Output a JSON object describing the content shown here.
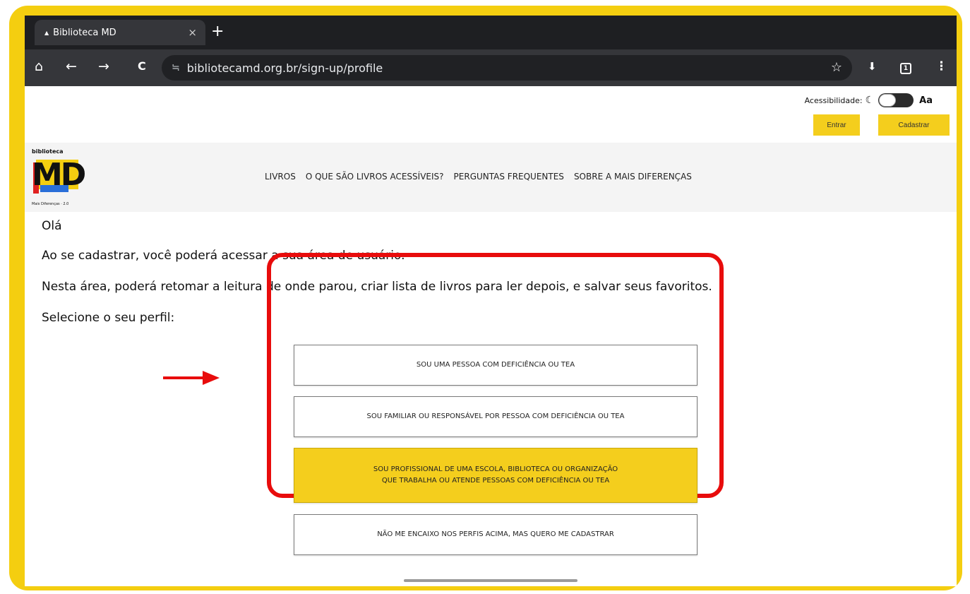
{
  "browser": {
    "tab_title": "Biblioteca MD",
    "tab_close": "×",
    "new_tab": "+",
    "url": "bibliotecamd.org.br/sign-up/profile",
    "icons": {
      "home": "⌂",
      "back": "←",
      "forward": "→",
      "reload": "C",
      "site_settings": "≒",
      "star": "☆",
      "mic": "🎙",
      "tab_count": "1",
      "menu": "⋮"
    }
  },
  "accessibility": {
    "label": "Acessibilidade:",
    "moon": "☾",
    "text_size": "Aa"
  },
  "header": {
    "login_label": "Entrar",
    "signup_label": "Cadastrar"
  },
  "logo": {
    "top_word": "biblioteca",
    "letters": "MD",
    "tagline": "Mais Diferenças · 2.0"
  },
  "nav": {
    "items": [
      "LIVROS",
      "O QUE SÃO LIVROS ACESSÍVEIS?",
      "PERGUNTAS FREQUENTES",
      "SOBRE A MAIS DIFERENÇAS"
    ]
  },
  "content": {
    "greeting": "Olá",
    "line1": "Ao se cadastrar, você poderá acessar a sua área de usuário.",
    "line2": "Nesta área, poderá retomar a leitura de onde parou, criar lista de livros para ler depois, e salvar seus favoritos.",
    "line3": "Selecione o seu perfil:"
  },
  "profiles": [
    {
      "label": "SOU UMA PESSOA COM DEFICIÊNCIA OU TEA",
      "selected": false
    },
    {
      "label": "SOU FAMILIAR OU RESPONSÁVEL POR PESSOA COM DEFICIÊNCIA OU TEA",
      "selected": false
    },
    {
      "label_line1": "SOU PROFISSIONAL DE UMA ESCOLA, BIBLIOTECA OU ORGANIZAÇÃO",
      "label_line2": "QUE TRABALHA OU ATENDE PESSOAS COM DEFICIÊNCIA OU TEA",
      "selected": true
    },
    {
      "label": "NÃO ME ENCAIXO NOS PERFIS ACIMA, MAS QUERO ME CADASTRAR",
      "selected": false
    }
  ],
  "colors": {
    "frame": "#f4ce10",
    "accent_yellow": "#f4ce1d",
    "highlight_red": "#e80c0c",
    "chrome_dark": "#35363a"
  }
}
